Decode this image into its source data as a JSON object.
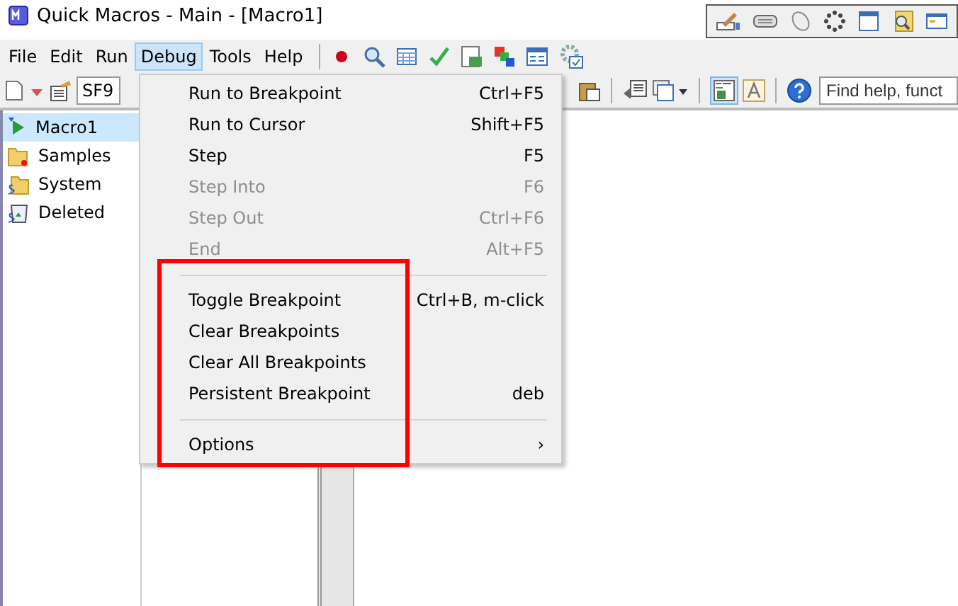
{
  "window": {
    "title": "Quick Macros - Main - [Macro1]"
  },
  "menubar": [
    {
      "label": "File",
      "selected": false
    },
    {
      "label": "Edit",
      "selected": false
    },
    {
      "label": "Run",
      "selected": false
    },
    {
      "label": "Debug",
      "selected": true
    },
    {
      "label": "Tools",
      "selected": false
    },
    {
      "label": "Help",
      "selected": false
    }
  ],
  "toolbar": {
    "combo": {
      "value": "SF9"
    },
    "search": {
      "placeholder": "Find help, funct"
    }
  },
  "tree": [
    {
      "label": "Macro1",
      "selected": true,
      "kind": "macro"
    },
    {
      "label": "Samples",
      "selected": false,
      "kind": "folder"
    },
    {
      "label": "System",
      "selected": false,
      "kind": "system"
    },
    {
      "label": "Deleted",
      "selected": false,
      "kind": "bin"
    }
  ],
  "menu": [
    {
      "kind": "item",
      "label": "Run to Breakpoint",
      "shortcut": "Ctrl+F5",
      "disabled": false
    },
    {
      "kind": "item",
      "label": "Run to Cursor",
      "shortcut": "Shift+F5",
      "disabled": false
    },
    {
      "kind": "item",
      "label": "Step",
      "shortcut": "F5",
      "disabled": false
    },
    {
      "kind": "item",
      "label": "Step Into",
      "shortcut": "F6",
      "disabled": true
    },
    {
      "kind": "item",
      "label": "Step Out",
      "shortcut": "Ctrl+F6",
      "disabled": true
    },
    {
      "kind": "item",
      "label": "End",
      "shortcut": "Alt+F5",
      "disabled": true
    },
    {
      "kind": "separator"
    },
    {
      "kind": "item",
      "label": "Toggle Breakpoint",
      "shortcut": "Ctrl+B, m-click",
      "disabled": false
    },
    {
      "kind": "item",
      "label": "Clear Breakpoints",
      "disabled": false
    },
    {
      "kind": "item",
      "label": "Clear All Breakpoints",
      "disabled": false
    },
    {
      "kind": "item",
      "label": "Persistent Breakpoint",
      "shortcut": "deb",
      "disabled": false
    },
    {
      "kind": "separator"
    },
    {
      "kind": "submenu",
      "label": "Options",
      "arrow": "›",
      "disabled": false
    }
  ],
  "annotation": {
    "kind": "rectangle",
    "color": "#ff0000"
  }
}
